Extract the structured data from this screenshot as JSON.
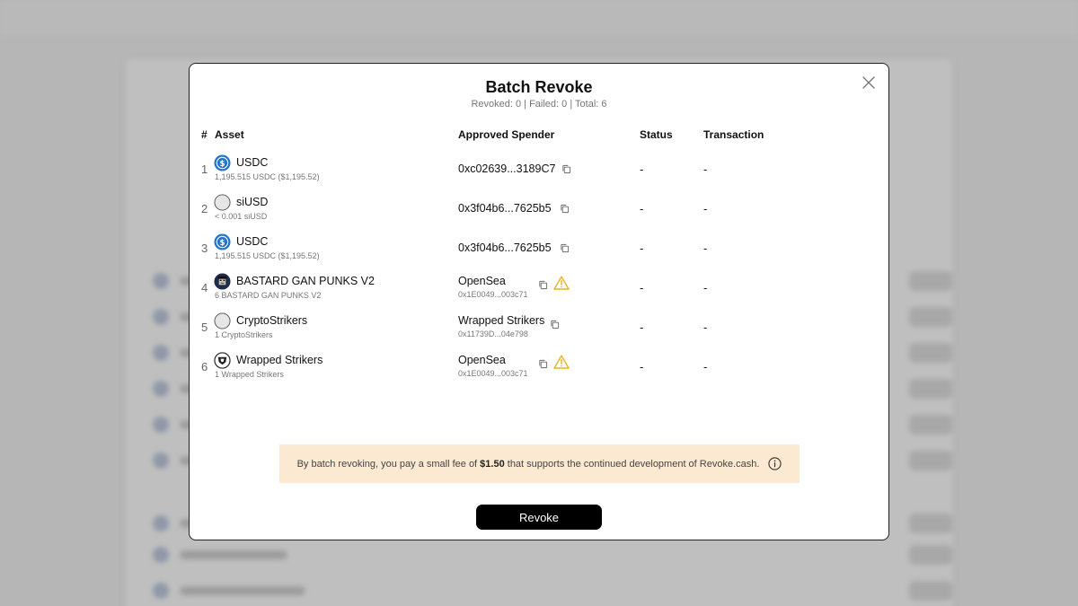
{
  "modal": {
    "title": "Batch Revoke",
    "summary": "Revoked: 0 | Failed: 0 | Total: 6",
    "columns": {
      "index": "#",
      "asset": "Asset",
      "spender": "Approved Spender",
      "status": "Status",
      "transaction": "Transaction"
    },
    "rows": [
      {
        "index": "1",
        "asset_name": "USDC",
        "asset_icon": "usdc-icon",
        "asset_detail": "1,195.515 USDC ($1,195.52)",
        "spender_address": "0xc02639...3189C7",
        "status": "-",
        "transaction": "-"
      },
      {
        "index": "2",
        "asset_name": "siUSD",
        "asset_icon": "placeholder-token-icon",
        "asset_detail": "< 0.001 siUSD",
        "spender_address": "0x3f04b6...7625b5",
        "status": "-",
        "transaction": "-"
      },
      {
        "index": "3",
        "asset_name": "USDC",
        "asset_icon": "usdc-icon",
        "asset_detail": "1,195.515 USDC ($1,195.52)",
        "spender_address": "0x3f04b6...7625b5",
        "status": "-",
        "transaction": "-"
      },
      {
        "index": "4",
        "asset_name": "BASTARD GAN PUNKS V2",
        "asset_icon": "punk-avatar-icon",
        "asset_detail": "6 BASTARD GAN PUNKS V2",
        "spender_name": "OpenSea",
        "spender_address": "0x1E0049...003c71",
        "status": "-",
        "transaction": "-"
      },
      {
        "index": "5",
        "asset_name": "CryptoStrikers",
        "asset_icon": "placeholder-token-icon",
        "asset_detail": "1 CryptoStrikers",
        "spender_name": "Wrapped Strikers",
        "spender_address": "0x11739D...04e798",
        "status": "-",
        "transaction": "-"
      },
      {
        "index": "6",
        "asset_name": "Wrapped Strikers",
        "asset_icon": "wrapped-strikers-icon",
        "asset_detail": "1 Wrapped Strikers",
        "spender_name": "OpenSea",
        "spender_address": "0x1E0049...003c71",
        "status": "-",
        "transaction": "-"
      }
    ],
    "fee_note": {
      "prefix": "By batch revoking, you pay a small fee of ",
      "amount": "$1.50",
      "suffix": " that supports the continued development of Revoke.cash."
    },
    "revoke_label": "Revoke"
  },
  "colors": {
    "warning": "#e8b321",
    "usdc_blue": "#2775ca",
    "fee_note_bg": "#fbe9d2",
    "button_bg": "#000000"
  }
}
